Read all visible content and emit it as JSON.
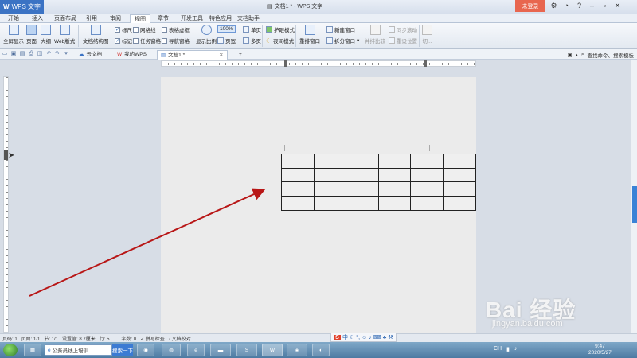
{
  "titlebar": {
    "app_name": "WPS 文字",
    "window_title": "文档1 * - WPS 文字",
    "login_label": "未登录"
  },
  "menu": {
    "tabs": [
      "开始",
      "插入",
      "页面布局",
      "引用",
      "审阅",
      "视图",
      "章节",
      "开发工具",
      "特色应用",
      "文档助手"
    ],
    "active": "视图"
  },
  "ribbon": {
    "fullscreen": "全屏显示",
    "page_view": "页面",
    "outline": "大纲",
    "web_layout": "Web版式",
    "doc_structure": "文档结构图",
    "ruler": "标尺",
    "gridlines": "网格线",
    "table_gridlines": "表格虚框",
    "markup": "标记",
    "task_pane": "任务窗格",
    "nav_pane": "导航窗格",
    "zoom_label": "显示比例",
    "zoom_value": "100%",
    "one_page": "单页",
    "page_width": "页宽",
    "multi_page": "多页",
    "eye_mode": "护眼模式",
    "night_mode": "夜间模式",
    "arrange_windows": "重排窗口",
    "new_window": "新建窗口",
    "split_window": "拆分窗口",
    "compare": "并排比较",
    "sync_scroll": "同步滚动",
    "reset_position": "重设位置",
    "switch_window": "切..."
  },
  "doctabs": {
    "cloud": "云文档",
    "my_wps": "我的WPS",
    "doc1": "文档1 *"
  },
  "search_hint": "查找命令、搜索模板",
  "statusbar": {
    "page_num": "页码: 1",
    "pages": "页面: 1/1",
    "section": "节: 1/1",
    "setting": "设置值: 8.7厘米",
    "row": "行: 5",
    "words": "字数: 0",
    "spell_check": "拼写检查",
    "doc_check": "文档校对"
  },
  "ime": {
    "label": "中"
  },
  "taskbar": {
    "search_placeholder": "公务员线上培训",
    "search_button": "搜索一下",
    "time": "9:47",
    "date": "2020/5/27",
    "lang": "CH"
  },
  "watermark": {
    "brand": "Bai 经验",
    "url": "jingyan.baidu.com"
  },
  "table": {
    "rows": 4,
    "cols": 6
  }
}
